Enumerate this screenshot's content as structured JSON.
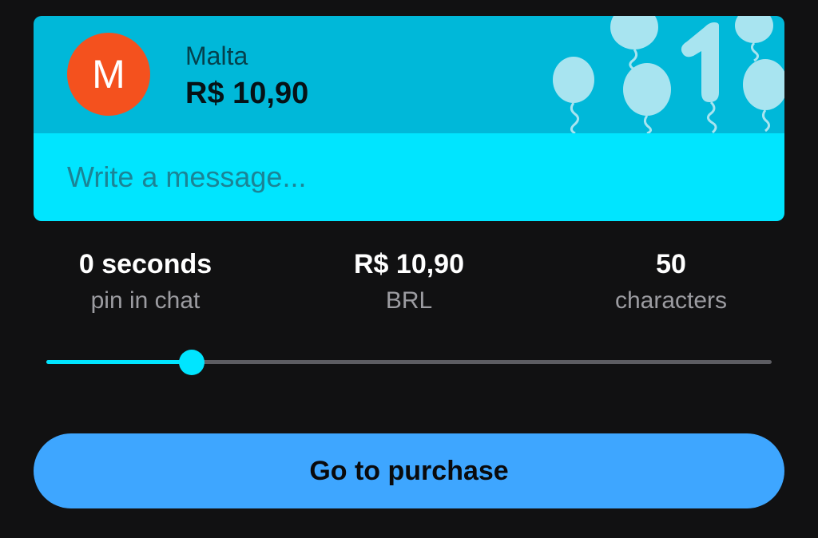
{
  "card": {
    "avatar_letter": "M",
    "name": "Malta",
    "amount": "R$ 10,90",
    "message_placeholder": "Write a message...",
    "message_value": "",
    "colors": {
      "header": "#00b8d9",
      "message_area": "#00e5ff",
      "avatar": "#f4511e"
    },
    "decoration_icon": "balloons-with-number-1"
  },
  "stats": [
    {
      "value": "0 seconds",
      "label": "pin in chat"
    },
    {
      "value": "R$ 10,90",
      "label": "BRL"
    },
    {
      "value": "50",
      "label": "characters"
    }
  ],
  "slider": {
    "level": 0.2
  },
  "purchase": {
    "label": "Go to purchase",
    "color": "#3ea6ff"
  },
  "background_color": "#111112"
}
